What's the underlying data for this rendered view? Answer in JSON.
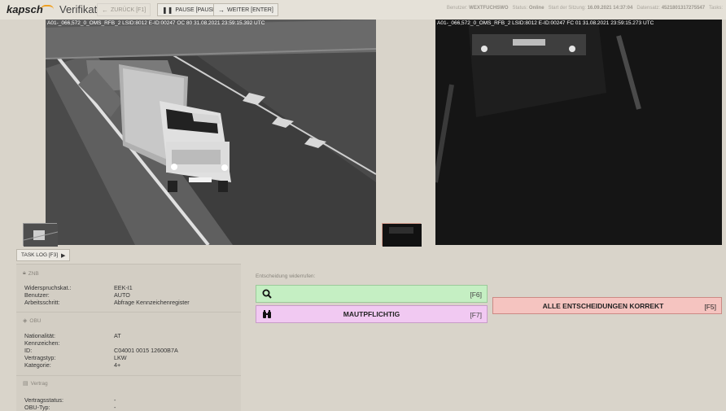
{
  "header": {
    "logo": "kapsch",
    "title": "Verifikation",
    "buttons": {
      "back": "ZURÜCK [F1]",
      "pause": "PAUSE [PAUSE]",
      "next": "WEITER [ENTER]"
    },
    "status": {
      "user_label": "Benutzer:",
      "user": "WEXTFUCHSWO",
      "status_label": "Status:",
      "status": "Online",
      "session_label": "Start der Sitzung:",
      "session": "16.09.2021 14:37:04",
      "record_label": "Datensatz:",
      "record": "4521801317275547",
      "task_label": "Tasks:"
    }
  },
  "camera": {
    "left_caption": "A01-_066,572_0_OMS_RFB_2 LSID:8012 E-ID:00247 OC 80 31.08.2021 23:59:15.392 UTC",
    "right_caption": "A01-_066,572_0_OMS_RFB_2 LSID:8012 E-ID:00247 FC 01 31.08.2021 23:59:15.273 UTC"
  },
  "tasklog": {
    "label": "TASK LOG [F3]"
  },
  "znb": {
    "title": "ZNB",
    "rows": [
      {
        "label": "Widerspruchskat.:",
        "value": "EEK-I1"
      },
      {
        "label": "Benutzer:",
        "value": "AUTO"
      },
      {
        "label": "Arbeitsschritt:",
        "value": "Abfrage Kennzeichenregister"
      }
    ]
  },
  "obu": {
    "title": "OBU",
    "rows": [
      {
        "label": "Nationalität:",
        "value": "AT"
      },
      {
        "label": "Kennzeichen:",
        "value": ""
      },
      {
        "label": "ID:",
        "value": "C04001 0015 12600B7A"
      },
      {
        "label": "Vertragstyp:",
        "value": "LKW"
      },
      {
        "label": "Kategorie:",
        "value": "4+"
      }
    ]
  },
  "vertrag": {
    "title": "Vertrag",
    "rows": [
      {
        "label": "Vertragsstatus:",
        "value": "-"
      },
      {
        "label": "OBU-Typ:",
        "value": "-"
      }
    ]
  },
  "decision": {
    "label": "Entscheidung widerrufen:",
    "search": {
      "label": "",
      "key": "[F6]"
    },
    "maut": {
      "label": "MAUTPFLICHTIG",
      "key": "[F7]"
    },
    "all_correct": {
      "label": "ALLE ENTSCHEIDUNGEN KORREKT",
      "key": "[F5]"
    }
  },
  "colors": {
    "search_btn": "#c5efc3",
    "maut_btn": "#f1c9f2",
    "all_btn": "#f5c4c0",
    "accent": "#f0a020"
  }
}
